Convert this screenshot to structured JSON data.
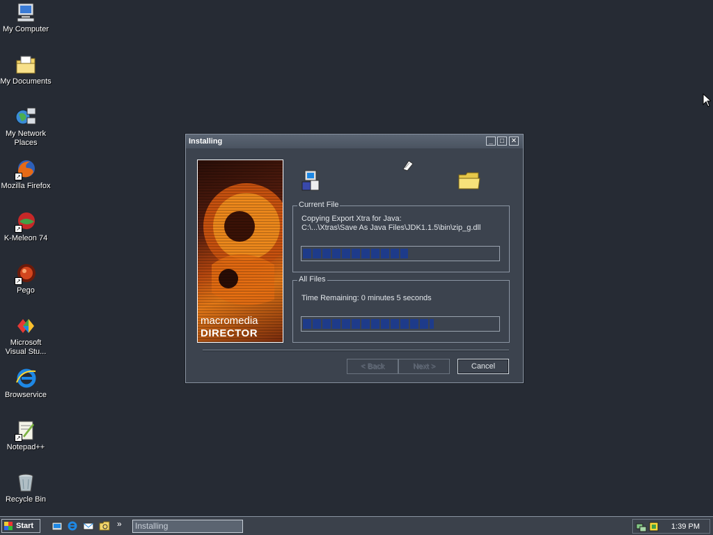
{
  "desktop": {
    "icons": [
      {
        "label": "My Computer"
      },
      {
        "label": "My Documents"
      },
      {
        "label": "My Network Places"
      },
      {
        "label": "Mozilla Firefox"
      },
      {
        "label": "K-Meleon 74"
      },
      {
        "label": "Pego"
      },
      {
        "label": "Microsoft Visual Stu..."
      },
      {
        "label": "Browservice"
      },
      {
        "label": "Notepad++"
      },
      {
        "label": "Recycle Bin"
      }
    ]
  },
  "window": {
    "title": "Installing",
    "banner": {
      "line1": "macromedia",
      "line2": "DIRECTOR"
    },
    "current_file": {
      "legend": "Current File",
      "line1": "Copying Export Xtra for Java:",
      "line2": "C:\\...\\Xtras\\Save As Java Files\\JDK1.1.5\\bin\\zip_g.dll",
      "progress": 0.54
    },
    "all_files": {
      "legend": "All Files",
      "time_remaining": "Time Remaining: 0 minutes 5 seconds",
      "progress": 0.67
    },
    "buttons": {
      "back": "< Back",
      "next": "Next >",
      "cancel": "Cancel"
    }
  },
  "taskbar": {
    "start": "Start",
    "task": "Installing",
    "clock": "1:39 PM",
    "overflow": "»"
  },
  "colors": {
    "desktop": "#262b34",
    "window": "#3c434e",
    "progress_fill": "#1e3b8a"
  }
}
